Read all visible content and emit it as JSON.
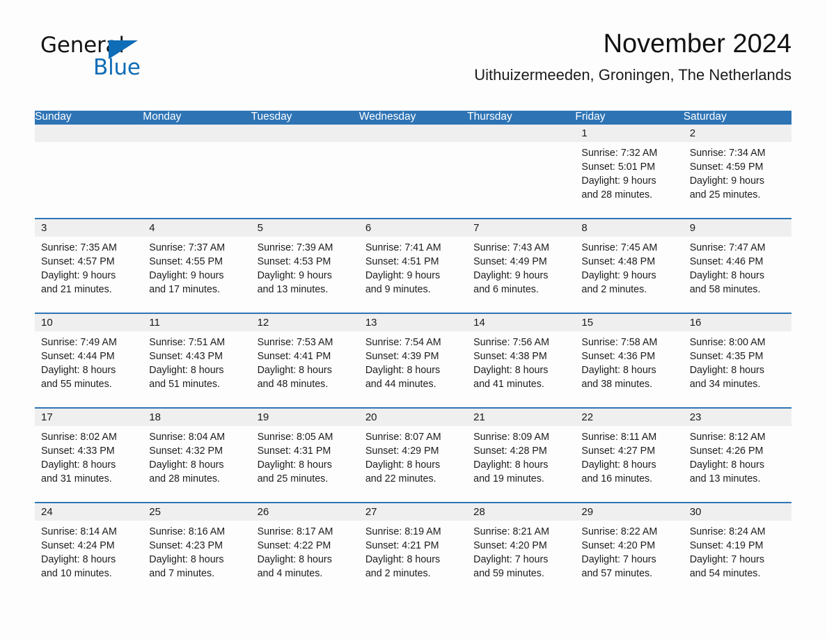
{
  "brand": {
    "name_part1": "General",
    "name_part2": "Blue",
    "accent_color": "#0f6cb6"
  },
  "header": {
    "month_title": "November 2024",
    "location": "Uithuizermeeden, Groningen, The Netherlands"
  },
  "colors": {
    "header_row_bg": "#2e74b5",
    "daynum_band_bg": "#efefef",
    "page_bg": "#fdfdfd",
    "text": "#1a1a1a"
  },
  "weekday_headers": [
    "Sunday",
    "Monday",
    "Tuesday",
    "Wednesday",
    "Thursday",
    "Friday",
    "Saturday"
  ],
  "weeks": [
    [
      {
        "day": "",
        "sunrise": "",
        "sunset": "",
        "daylight_line1": "",
        "daylight_line2": "",
        "empty": true
      },
      {
        "day": "",
        "sunrise": "",
        "sunset": "",
        "daylight_line1": "",
        "daylight_line2": "",
        "empty": true
      },
      {
        "day": "",
        "sunrise": "",
        "sunset": "",
        "daylight_line1": "",
        "daylight_line2": "",
        "empty": true
      },
      {
        "day": "",
        "sunrise": "",
        "sunset": "",
        "daylight_line1": "",
        "daylight_line2": "",
        "empty": true
      },
      {
        "day": "",
        "sunrise": "",
        "sunset": "",
        "daylight_line1": "",
        "daylight_line2": "",
        "empty": true
      },
      {
        "day": "1",
        "sunrise": "Sunrise: 7:32 AM",
        "sunset": "Sunset: 5:01 PM",
        "daylight_line1": "Daylight: 9 hours",
        "daylight_line2": "and 28 minutes.",
        "empty": false
      },
      {
        "day": "2",
        "sunrise": "Sunrise: 7:34 AM",
        "sunset": "Sunset: 4:59 PM",
        "daylight_line1": "Daylight: 9 hours",
        "daylight_line2": "and 25 minutes.",
        "empty": false
      }
    ],
    [
      {
        "day": "3",
        "sunrise": "Sunrise: 7:35 AM",
        "sunset": "Sunset: 4:57 PM",
        "daylight_line1": "Daylight: 9 hours",
        "daylight_line2": "and 21 minutes.",
        "empty": false
      },
      {
        "day": "4",
        "sunrise": "Sunrise: 7:37 AM",
        "sunset": "Sunset: 4:55 PM",
        "daylight_line1": "Daylight: 9 hours",
        "daylight_line2": "and 17 minutes.",
        "empty": false
      },
      {
        "day": "5",
        "sunrise": "Sunrise: 7:39 AM",
        "sunset": "Sunset: 4:53 PM",
        "daylight_line1": "Daylight: 9 hours",
        "daylight_line2": "and 13 minutes.",
        "empty": false
      },
      {
        "day": "6",
        "sunrise": "Sunrise: 7:41 AM",
        "sunset": "Sunset: 4:51 PM",
        "daylight_line1": "Daylight: 9 hours",
        "daylight_line2": "and 9 minutes.",
        "empty": false
      },
      {
        "day": "7",
        "sunrise": "Sunrise: 7:43 AM",
        "sunset": "Sunset: 4:49 PM",
        "daylight_line1": "Daylight: 9 hours",
        "daylight_line2": "and 6 minutes.",
        "empty": false
      },
      {
        "day": "8",
        "sunrise": "Sunrise: 7:45 AM",
        "sunset": "Sunset: 4:48 PM",
        "daylight_line1": "Daylight: 9 hours",
        "daylight_line2": "and 2 minutes.",
        "empty": false
      },
      {
        "day": "9",
        "sunrise": "Sunrise: 7:47 AM",
        "sunset": "Sunset: 4:46 PM",
        "daylight_line1": "Daylight: 8 hours",
        "daylight_line2": "and 58 minutes.",
        "empty": false
      }
    ],
    [
      {
        "day": "10",
        "sunrise": "Sunrise: 7:49 AM",
        "sunset": "Sunset: 4:44 PM",
        "daylight_line1": "Daylight: 8 hours",
        "daylight_line2": "and 55 minutes.",
        "empty": false
      },
      {
        "day": "11",
        "sunrise": "Sunrise: 7:51 AM",
        "sunset": "Sunset: 4:43 PM",
        "daylight_line1": "Daylight: 8 hours",
        "daylight_line2": "and 51 minutes.",
        "empty": false
      },
      {
        "day": "12",
        "sunrise": "Sunrise: 7:53 AM",
        "sunset": "Sunset: 4:41 PM",
        "daylight_line1": "Daylight: 8 hours",
        "daylight_line2": "and 48 minutes.",
        "empty": false
      },
      {
        "day": "13",
        "sunrise": "Sunrise: 7:54 AM",
        "sunset": "Sunset: 4:39 PM",
        "daylight_line1": "Daylight: 8 hours",
        "daylight_line2": "and 44 minutes.",
        "empty": false
      },
      {
        "day": "14",
        "sunrise": "Sunrise: 7:56 AM",
        "sunset": "Sunset: 4:38 PM",
        "daylight_line1": "Daylight: 8 hours",
        "daylight_line2": "and 41 minutes.",
        "empty": false
      },
      {
        "day": "15",
        "sunrise": "Sunrise: 7:58 AM",
        "sunset": "Sunset: 4:36 PM",
        "daylight_line1": "Daylight: 8 hours",
        "daylight_line2": "and 38 minutes.",
        "empty": false
      },
      {
        "day": "16",
        "sunrise": "Sunrise: 8:00 AM",
        "sunset": "Sunset: 4:35 PM",
        "daylight_line1": "Daylight: 8 hours",
        "daylight_line2": "and 34 minutes.",
        "empty": false
      }
    ],
    [
      {
        "day": "17",
        "sunrise": "Sunrise: 8:02 AM",
        "sunset": "Sunset: 4:33 PM",
        "daylight_line1": "Daylight: 8 hours",
        "daylight_line2": "and 31 minutes.",
        "empty": false
      },
      {
        "day": "18",
        "sunrise": "Sunrise: 8:04 AM",
        "sunset": "Sunset: 4:32 PM",
        "daylight_line1": "Daylight: 8 hours",
        "daylight_line2": "and 28 minutes.",
        "empty": false
      },
      {
        "day": "19",
        "sunrise": "Sunrise: 8:05 AM",
        "sunset": "Sunset: 4:31 PM",
        "daylight_line1": "Daylight: 8 hours",
        "daylight_line2": "and 25 minutes.",
        "empty": false
      },
      {
        "day": "20",
        "sunrise": "Sunrise: 8:07 AM",
        "sunset": "Sunset: 4:29 PM",
        "daylight_line1": "Daylight: 8 hours",
        "daylight_line2": "and 22 minutes.",
        "empty": false
      },
      {
        "day": "21",
        "sunrise": "Sunrise: 8:09 AM",
        "sunset": "Sunset: 4:28 PM",
        "daylight_line1": "Daylight: 8 hours",
        "daylight_line2": "and 19 minutes.",
        "empty": false
      },
      {
        "day": "22",
        "sunrise": "Sunrise: 8:11 AM",
        "sunset": "Sunset: 4:27 PM",
        "daylight_line1": "Daylight: 8 hours",
        "daylight_line2": "and 16 minutes.",
        "empty": false
      },
      {
        "day": "23",
        "sunrise": "Sunrise: 8:12 AM",
        "sunset": "Sunset: 4:26 PM",
        "daylight_line1": "Daylight: 8 hours",
        "daylight_line2": "and 13 minutes.",
        "empty": false
      }
    ],
    [
      {
        "day": "24",
        "sunrise": "Sunrise: 8:14 AM",
        "sunset": "Sunset: 4:24 PM",
        "daylight_line1": "Daylight: 8 hours",
        "daylight_line2": "and 10 minutes.",
        "empty": false
      },
      {
        "day": "25",
        "sunrise": "Sunrise: 8:16 AM",
        "sunset": "Sunset: 4:23 PM",
        "daylight_line1": "Daylight: 8 hours",
        "daylight_line2": "and 7 minutes.",
        "empty": false
      },
      {
        "day": "26",
        "sunrise": "Sunrise: 8:17 AM",
        "sunset": "Sunset: 4:22 PM",
        "daylight_line1": "Daylight: 8 hours",
        "daylight_line2": "and 4 minutes.",
        "empty": false
      },
      {
        "day": "27",
        "sunrise": "Sunrise: 8:19 AM",
        "sunset": "Sunset: 4:21 PM",
        "daylight_line1": "Daylight: 8 hours",
        "daylight_line2": "and 2 minutes.",
        "empty": false
      },
      {
        "day": "28",
        "sunrise": "Sunrise: 8:21 AM",
        "sunset": "Sunset: 4:20 PM",
        "daylight_line1": "Daylight: 7 hours",
        "daylight_line2": "and 59 minutes.",
        "empty": false
      },
      {
        "day": "29",
        "sunrise": "Sunrise: 8:22 AM",
        "sunset": "Sunset: 4:20 PM",
        "daylight_line1": "Daylight: 7 hours",
        "daylight_line2": "and 57 minutes.",
        "empty": false
      },
      {
        "day": "30",
        "sunrise": "Sunrise: 8:24 AM",
        "sunset": "Sunset: 4:19 PM",
        "daylight_line1": "Daylight: 7 hours",
        "daylight_line2": "and 54 minutes.",
        "empty": false
      }
    ]
  ]
}
